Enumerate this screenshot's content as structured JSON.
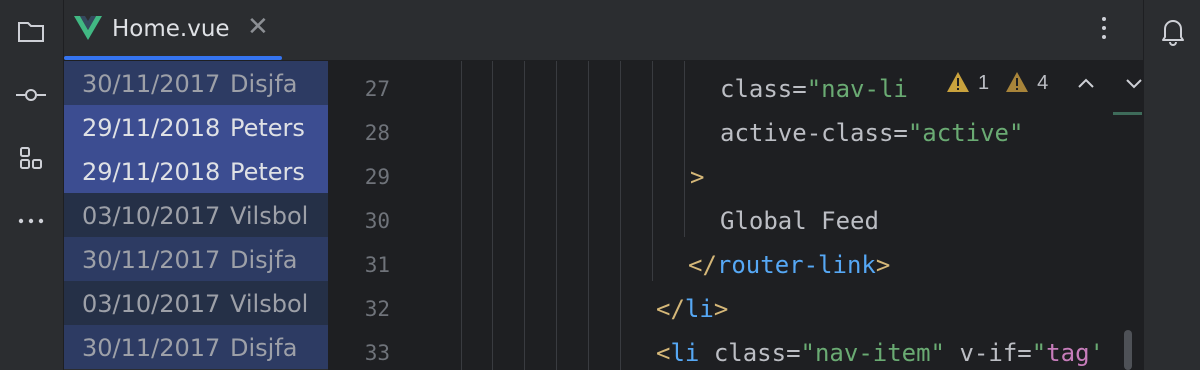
{
  "tab": {
    "title": "Home.vue",
    "close_glyph": "✕"
  },
  "colors": {
    "accent": "#3574f0",
    "vue_green": "#41b883",
    "warning": "#c9a23d",
    "annotation_bg": "#2b2d30",
    "selected_bg": "#3d4b8c"
  },
  "left_toolbar": {
    "icons": [
      "folder-icon",
      "commit-icon",
      "structure-icon",
      "more-horizontal-icon"
    ]
  },
  "right_toolbar": {
    "icons": [
      "bell-icon"
    ]
  },
  "annotations": [
    {
      "date": "30/11/2017",
      "author": "Disjfa",
      "selected": false,
      "tone": "#2d3b63"
    },
    {
      "date": "29/11/2018",
      "author": "Peters",
      "selected": true,
      "tone": "#3c4d91"
    },
    {
      "date": "29/11/2018",
      "author": "Peters",
      "selected": true,
      "tone": "#3c4d91"
    },
    {
      "date": "03/10/2017",
      "author": "Vilsbol",
      "selected": false,
      "tone": "#253047"
    },
    {
      "date": "30/11/2017",
      "author": "Disjfa",
      "selected": false,
      "tone": "#2d3b63"
    },
    {
      "date": "03/10/2017",
      "author": "Vilsbol",
      "selected": false,
      "tone": "#253047"
    },
    {
      "date": "30/11/2017",
      "author": "Disjfa",
      "selected": false,
      "tone": "#2d3b63"
    }
  ],
  "line_numbers": [
    "27",
    "28",
    "29",
    "30",
    "31",
    "32",
    "33"
  ],
  "inspections": {
    "warning_a_count": "1",
    "warning_b_count": "4"
  },
  "code": {
    "l27": {
      "attr": "class",
      "eq": "=",
      "str": "\"nav-li"
    },
    "l28": {
      "attr": "active-class",
      "eq": "=",
      "str": "\"active\""
    },
    "l29": {
      "brk": ">"
    },
    "l30": {
      "txt": "Global Feed"
    },
    "l31": {
      "open": "</",
      "tag": "router-link",
      "close": ">"
    },
    "l32": {
      "open": "</",
      "tag": "li",
      "close": ">"
    },
    "l33": {
      "open": "<",
      "tag": "li",
      "sp1": " ",
      "attr1": "class",
      "eq1": "=",
      "str1": "\"nav-item\"",
      "sp2": " ",
      "attr2": "v-if",
      "eq2": "=",
      "str2": "\"",
      "vtag": "tag",
      "str3": "'"
    }
  }
}
